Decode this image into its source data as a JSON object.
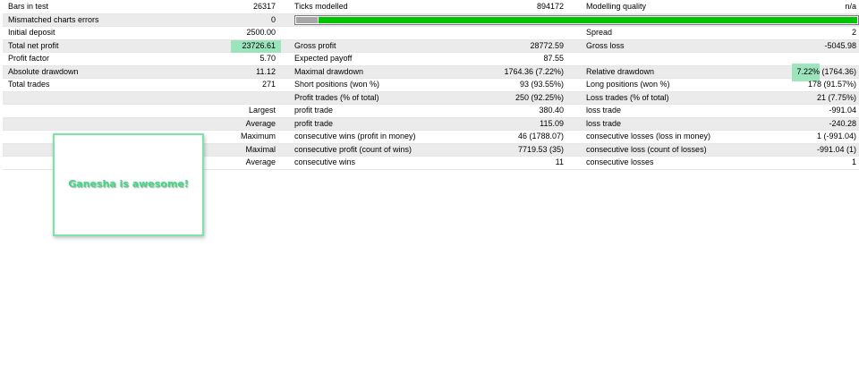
{
  "rows": [
    {
      "label1": "Bars in test",
      "value1": "26317",
      "label2": "Ticks modelled",
      "value2": "894172",
      "label3": "Modelling quality",
      "value3": "n/a"
    },
    {
      "label1": "Mismatched charts errors",
      "value1": "0",
      "label2": "",
      "value2": "",
      "label3": "",
      "value3": ""
    },
    {
      "label1": "Initial deposit",
      "value1": "2500.00",
      "label2": "",
      "value2": "",
      "label3": "Spread",
      "value3": "2"
    },
    {
      "label1": "Total net profit",
      "value1": "23726.61",
      "label2": "Gross profit",
      "value2": "28772.59",
      "label3": "Gross loss",
      "value3": "-5045.98"
    },
    {
      "label1": "Profit factor",
      "value1": "5.70",
      "label2": "Expected payoff",
      "value2": "87.55",
      "label3": "",
      "value3": ""
    },
    {
      "label1": "Absolute drawdown",
      "value1": "11.12",
      "label2": "Maximal drawdown",
      "value2": "1764.36 (7.22%)",
      "label3": "Relative drawdown",
      "value3": "7.22% (1764.36)"
    },
    {
      "label1": "Total trades",
      "value1": "271",
      "label2": "Short positions (won %)",
      "value2": "93 (93.55%)",
      "label3": "Long positions (won %)",
      "value3": "178 (91.57%)"
    },
    {
      "label1": "",
      "value1": "",
      "label2": "Profit trades (% of total)",
      "value2": "250 (92.25%)",
      "label3": "Loss trades (% of total)",
      "value3": "21 (7.75%)"
    },
    {
      "label1": "",
      "value1": "Largest",
      "label2": "profit trade",
      "value2": "380.40",
      "label3": "loss trade",
      "value3": "-991.04"
    },
    {
      "label1": "",
      "value1": "Average",
      "label2": "profit trade",
      "value2": "115.09",
      "label3": "loss trade",
      "value3": "-240.28"
    },
    {
      "label1": "",
      "value1": "Maximum",
      "label2": "consecutive wins (profit in money)",
      "value2": "46 (1788.07)",
      "label3": "consecutive losses (loss in money)",
      "value3": "1 (-991.04)"
    },
    {
      "label1": "",
      "value1": "Maximal",
      "label2": "consecutive profit (count of wins)",
      "value2": "7719.53 (35)",
      "label3": "consecutive loss (count of losses)",
      "value3": "-991.04 (1)"
    },
    {
      "label1": "",
      "value1": "Average",
      "label2": "consecutive wins",
      "value2": "11",
      "label3": "consecutive losses",
      "value3": "1"
    }
  ],
  "modelling_quality_bar": {
    "grey_color": "#a6a6a6",
    "green_color": "#00c400"
  },
  "highlight_color": "#8ee3b4",
  "annotation": {
    "text": "Ganesha is awesome!",
    "color": "#3ddc84"
  }
}
